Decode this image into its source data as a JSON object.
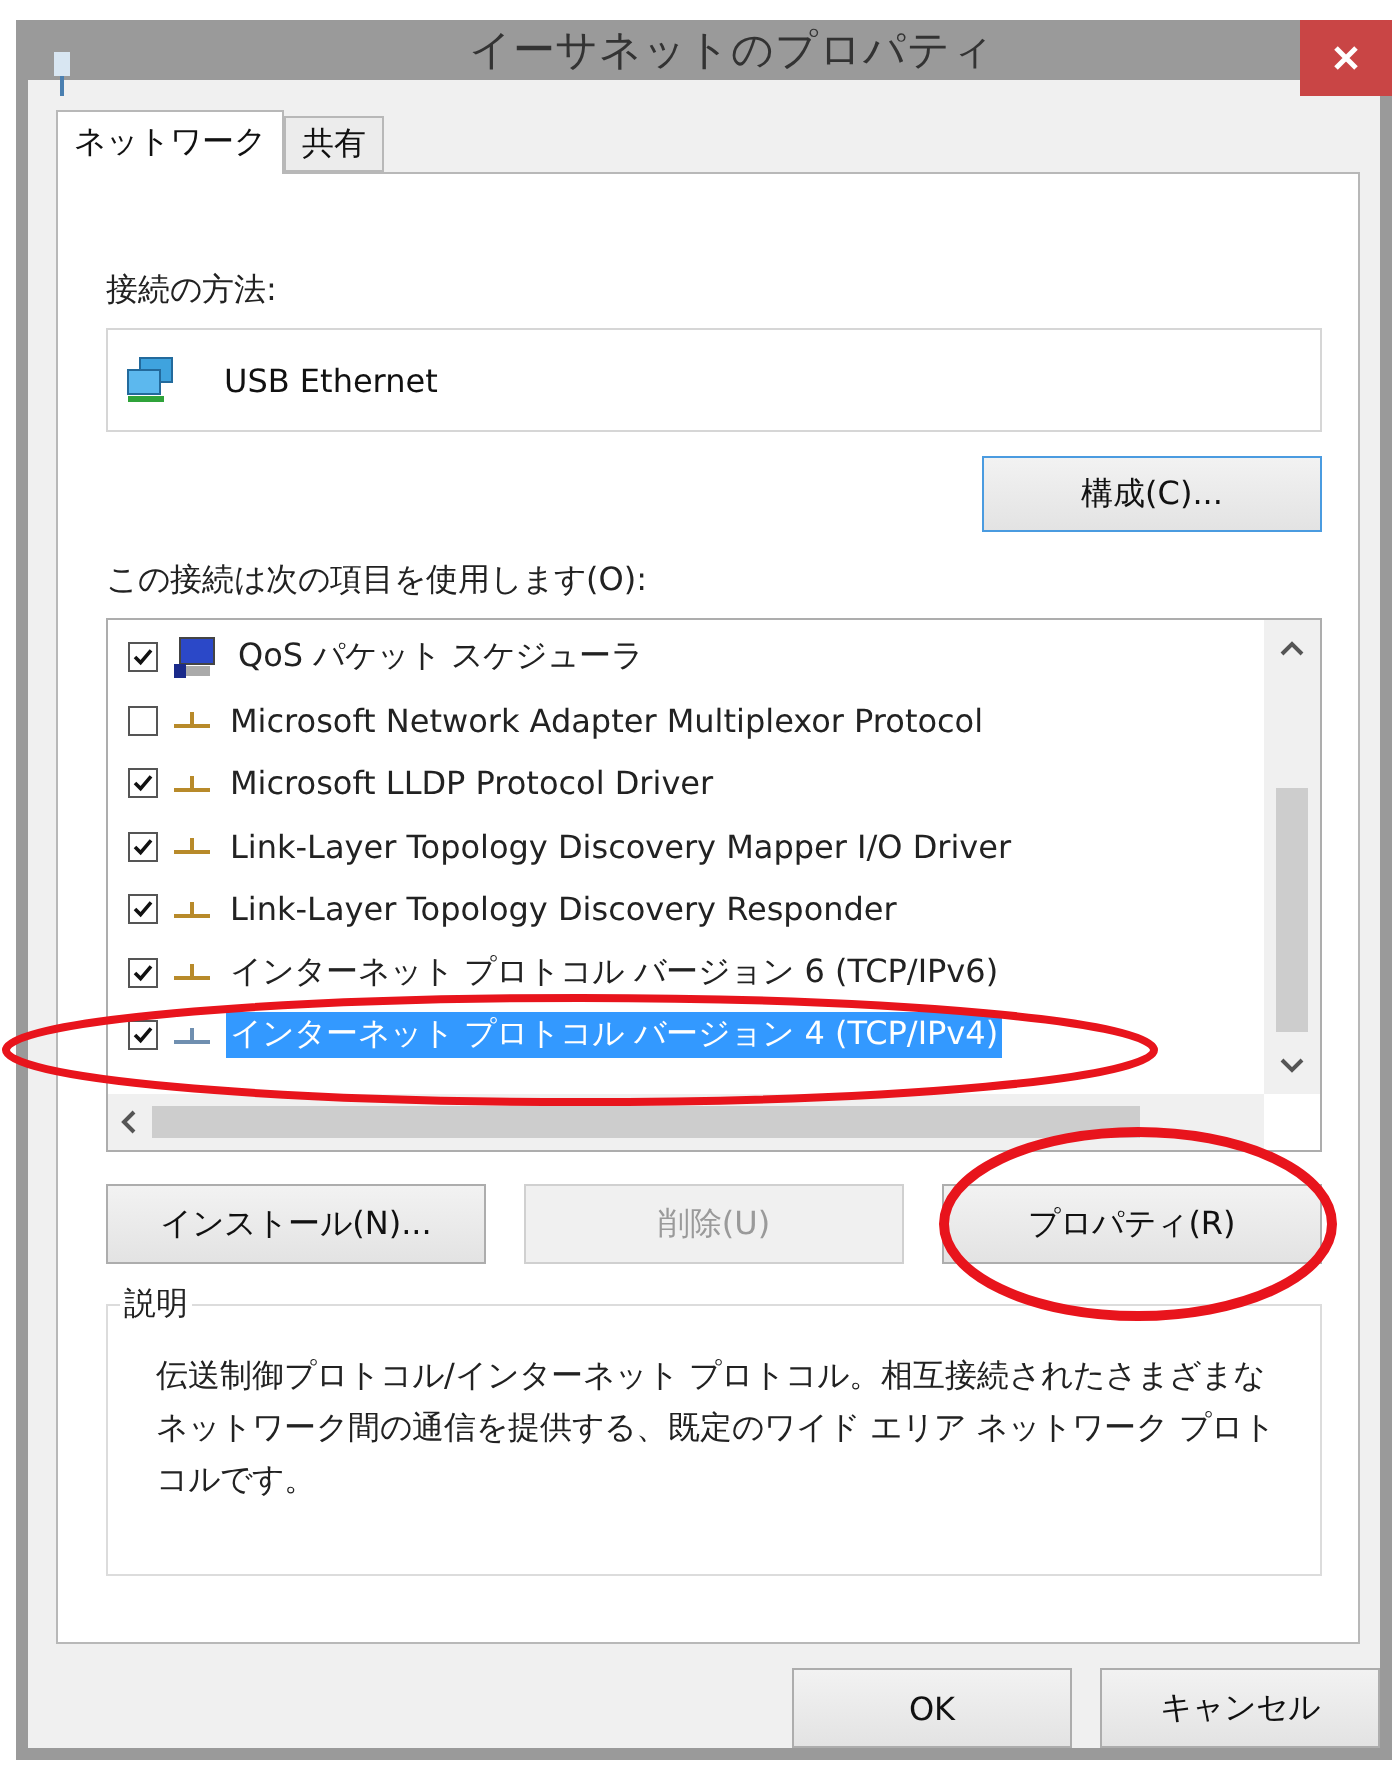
{
  "window": {
    "title": "イーサネットのプロパティ"
  },
  "tabs": [
    {
      "label": "ネットワーク",
      "selected": true
    },
    {
      "label": "共有",
      "selected": false
    }
  ],
  "connection": {
    "label": "接続の方法:",
    "adapter": "USB Ethernet",
    "configure_button": "構成(C)..."
  },
  "items_label": "この接続は次の項目を使用します(O):",
  "items": [
    {
      "kind": "service",
      "label": "QoS パケット スケジューラ",
      "checked": true,
      "selected": false
    },
    {
      "kind": "protocol",
      "label": "Microsoft Network Adapter Multiplexor Protocol",
      "checked": false,
      "selected": false
    },
    {
      "kind": "protocol",
      "label": "Microsoft LLDP Protocol Driver",
      "checked": true,
      "selected": false
    },
    {
      "kind": "protocol",
      "label": "Link-Layer Topology Discovery Mapper I/O Driver",
      "checked": true,
      "selected": false
    },
    {
      "kind": "protocol",
      "label": "Link-Layer Topology Discovery Responder",
      "checked": true,
      "selected": false
    },
    {
      "kind": "protocol",
      "label": "インターネット プロトコル バージョン 6 (TCP/IPv6)",
      "checked": true,
      "selected": false
    },
    {
      "kind": "protocol",
      "label": "インターネット プロトコル バージョン 4 (TCP/IPv4)",
      "checked": true,
      "selected": true
    }
  ],
  "item_buttons": [
    {
      "label": "インストール(N)...",
      "disabled": false
    },
    {
      "label": "削除(U)",
      "disabled": true
    },
    {
      "label": "プロパティ(R)",
      "disabled": false
    }
  ],
  "description": {
    "title": "説明",
    "text": "伝送制御プロトコル/インターネット プロトコル。相互接続されたさまざまなネットワーク間の通信を提供する、既定のワイド エリア ネットワーク プロトコルです。"
  },
  "dialog_buttons": [
    "OK",
    "キャンセル"
  ]
}
